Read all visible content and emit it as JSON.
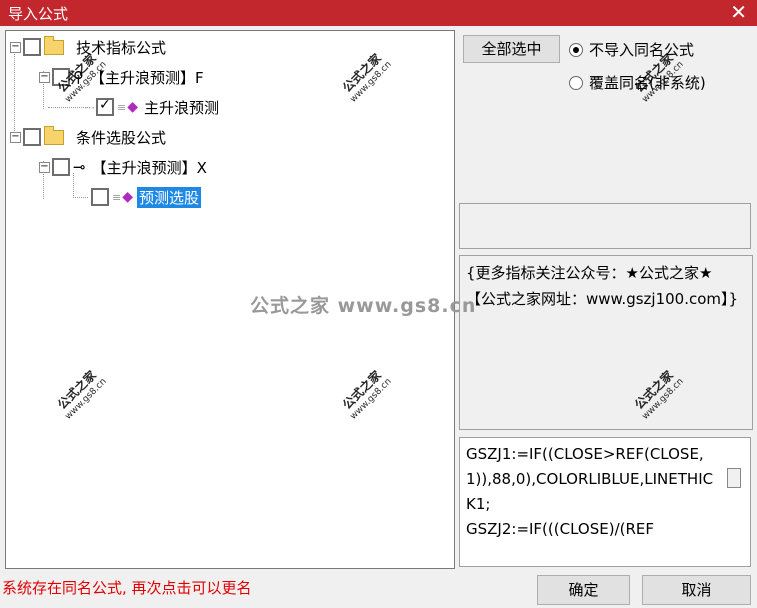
{
  "window": {
    "title": "导入公式",
    "close_glyph": "✕"
  },
  "tree": {
    "expander_glyph": "−",
    "nodes": [
      {
        "label": "技术指标公式",
        "checked": false
      },
      {
        "label": "【主升浪预测】F",
        "checked": false
      },
      {
        "label": "主升浪预测",
        "checked": true
      },
      {
        "label": "条件选股公式",
        "checked": false
      },
      {
        "label": "【主升浪预测】X",
        "checked": false
      },
      {
        "label": "预测选股",
        "checked": false,
        "selected": true
      }
    ]
  },
  "buttons": {
    "select_all": "全部选中",
    "ok": "确定",
    "cancel": "取消"
  },
  "options": {
    "no_import_same_name": "不导入同名公式",
    "overwrite_same_name": "覆盖同名(非系统)",
    "selected": "no_import_same_name"
  },
  "description": "{更多指标关注公众号：★公式之家★ 【公式之家网址：www.gszj100.com】}",
  "code": "GSZJ1:=IF((CLOSE>REF(CLOSE,1)),88,0),COLORLIBLUE,LINETHICK1;\nGSZJ2:=IF(((CLOSE)/(REF",
  "status": "系统存在同名公式, 再次点击可以更名",
  "watermarks": {
    "main": "公式之家",
    "sub": "www.gs8.cn",
    "center": "公式之家 www.gs8.cn"
  }
}
